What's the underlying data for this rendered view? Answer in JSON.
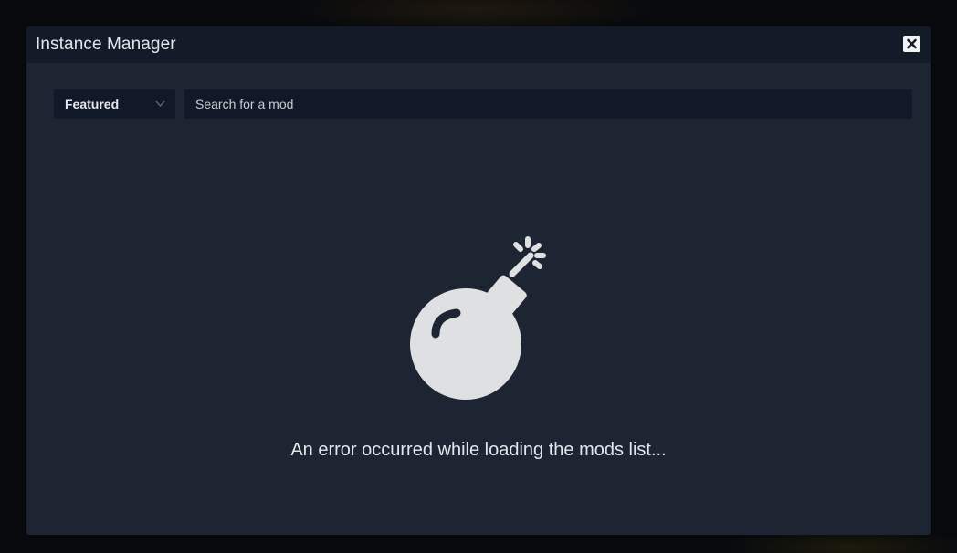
{
  "window": {
    "title": "Instance Manager",
    "close_icon": "close-icon"
  },
  "toolbar": {
    "sort_selected": "Featured",
    "sort_icon": "chevron-down-icon",
    "search_value": "",
    "search_placeholder": "Search for a mod"
  },
  "error_state": {
    "icon": "bomb-icon",
    "message": "An error occurred while loading the mods list..."
  },
  "colors": {
    "modal_background": "#1d2533",
    "header_background": "#141b28",
    "input_background": "#111827",
    "icon_color": "#dfe0e2",
    "text_color": "#e3e6ea"
  }
}
